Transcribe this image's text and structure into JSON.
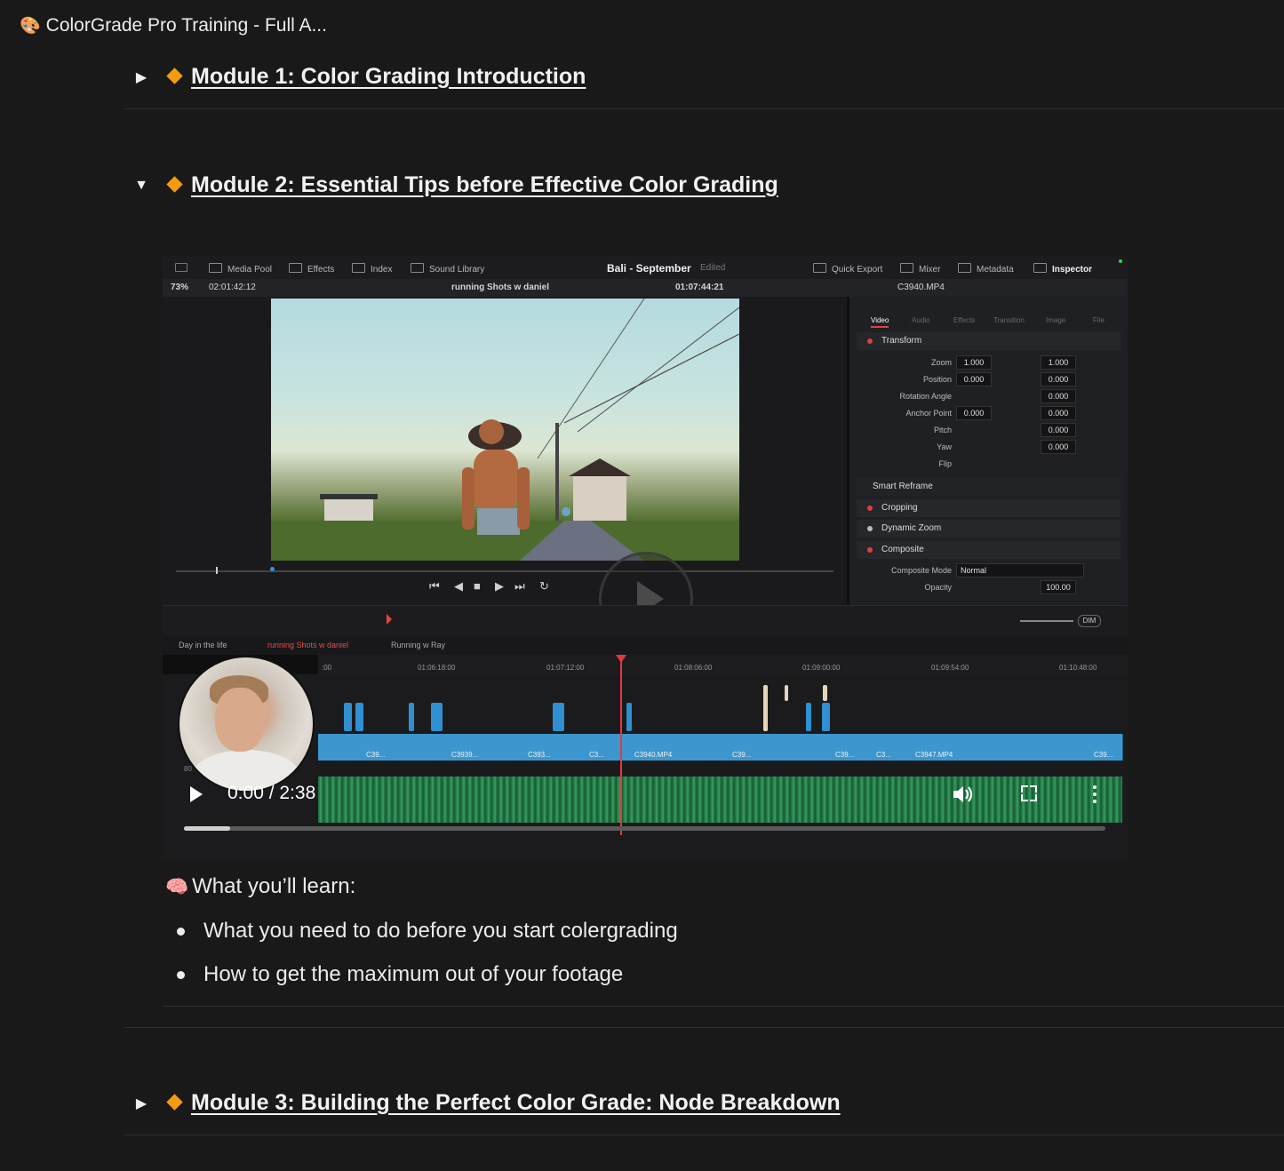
{
  "page": {
    "icon": "palette-icon",
    "title": "ColorGrade Pro Training - Full A..."
  },
  "modules": [
    {
      "label": "Module 1: Color Grading Introduction",
      "icon": "orange-diamond-icon",
      "expanded": false
    },
    {
      "label": "Module 2: Essential Tips before Effective Color Grading",
      "icon": "orange-diamond-icon",
      "expanded": true
    },
    {
      "label": "Module 3: Building the Perfect Color Grade: Node Breakdown",
      "icon": "orange-diamond-icon",
      "expanded": false
    }
  ],
  "video": {
    "current_time": "0:00 / 2:38",
    "progress": 0.05,
    "resolve": {
      "nav": [
        "Media Pool",
        "Effects",
        "Index",
        "Sound Library"
      ],
      "project": "Bali - September",
      "status": "Edited",
      "right_nav": [
        "Quick Export",
        "Mixer",
        "Metadata",
        "Inspector"
      ],
      "zoom": "73%",
      "timecode_left": "02:01:42:12",
      "timeline_name": "running Shots w daniel",
      "timecode_right": "01:07:44:21",
      "clip_name": "C3940.MP4",
      "inspector_tabs": [
        "Video",
        "Audio",
        "Effects",
        "Transition",
        "Image",
        "File"
      ],
      "sections": [
        "Transform",
        "Smart Reframe",
        "Cropping",
        "Dynamic Zoom",
        "Composite"
      ],
      "params": [
        {
          "label": "Zoom",
          "x": "1.000",
          "y": "1.000"
        },
        {
          "label": "Position",
          "x": "0.000",
          "y": "0.000"
        },
        {
          "label": "Rotation Angle",
          "v": "0.000"
        },
        {
          "label": "Anchor Point",
          "x": "0.000",
          "y": "0.000"
        },
        {
          "label": "Pitch",
          "v": "0.000"
        },
        {
          "label": "Yaw",
          "v": "0.000"
        },
        {
          "label": "Flip"
        }
      ],
      "composite_mode_label": "Composite Mode",
      "composite_mode": "Normal",
      "opacity_label": "Opacity",
      "opacity": "100.00",
      "timeline_tabs": [
        "Day in the life",
        "running Shots w daniel",
        "Running w Ray"
      ],
      "ruler": [
        ":00",
        "01:06:18:00",
        "01:07:12:00",
        "01:08:06:00",
        "01:09:00:00",
        "01:09:54:00",
        "01:10:48:00"
      ],
      "clips": [
        "C39...",
        "C3939...",
        "C393...",
        "C3...",
        "C3940.MP4",
        "C39...",
        "C39...",
        "C3...",
        "C3947.MP4",
        "C39..."
      ],
      "dim": "DIM",
      "track_number": "80"
    }
  },
  "learn": {
    "icon": "brain-icon",
    "title": "What you’ll learn:",
    "items": [
      "What you need to do before you start colergrading",
      "How to get the maximum out of your footage"
    ]
  },
  "colors": {
    "background": "#191919",
    "accent": "#f39c12",
    "resolve_clip": "#3d96cd",
    "playhead": "#e8383d"
  }
}
